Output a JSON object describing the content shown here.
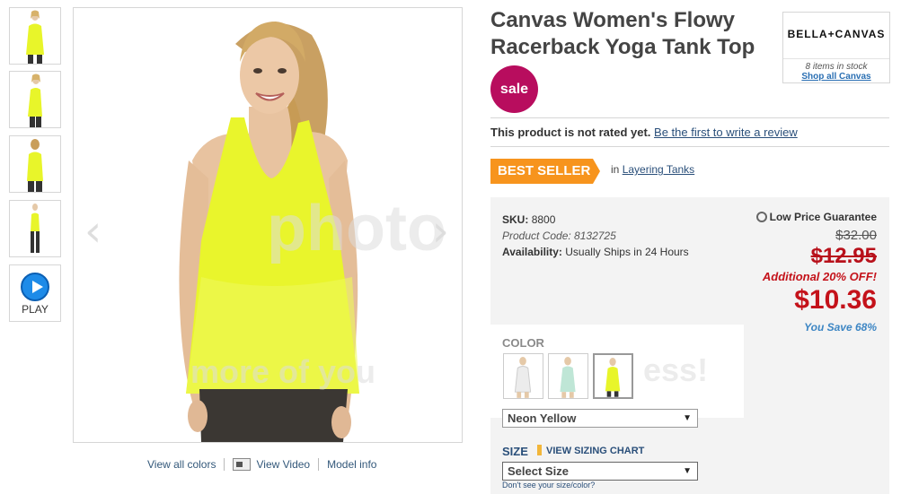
{
  "product": {
    "title": "Canvas Women's Flowy Racerback Yoga Tank Top",
    "sale_badge": "sale"
  },
  "gallery": {
    "video_label": "PLAY",
    "view_all_colors": "View all colors",
    "view_video": "View Video",
    "model_info": "Model info",
    "watermark_word": "photo",
    "watermark_phrase": "more of you",
    "watermark_tail": "ess!"
  },
  "brand": {
    "logo_text": "BELLA+CANVAS",
    "stock_text": "8 items in stock",
    "shop_link": "Shop all Canvas"
  },
  "rating": {
    "status": "This product is not rated yet.",
    "review_link": "Be the first to write a review"
  },
  "badges": {
    "best_seller": "BEST SELLER",
    "category_prefix": "in",
    "category_link": "Layering Tanks"
  },
  "details": {
    "sku_label": "SKU:",
    "sku_value": "8800",
    "product_code": "Product Code: 8132725",
    "availability_label": "Availability:",
    "availability_value": "Usually Ships in 24 Hours"
  },
  "pricing": {
    "guarantee": "Low Price Guarantee",
    "original": "$32.00",
    "sale": "$12.95",
    "additional": "Additional 20% OFF!",
    "final": "$10.36",
    "you_save": "You Save 68%"
  },
  "options": {
    "color_label": "COLOR",
    "selected_color": "Neon Yellow",
    "size_label": "SIZE",
    "sizing_chart": "VIEW SIZING CHART",
    "size_placeholder": "Select Size",
    "size_help": "Don't see your size/color?"
  },
  "colors": {
    "neon_yellow": "#e8f52a",
    "sale_badge": "#b80d5e",
    "best_seller": "#f7941d",
    "price_red": "#c4121a",
    "link_blue": "#2a4f7a"
  }
}
